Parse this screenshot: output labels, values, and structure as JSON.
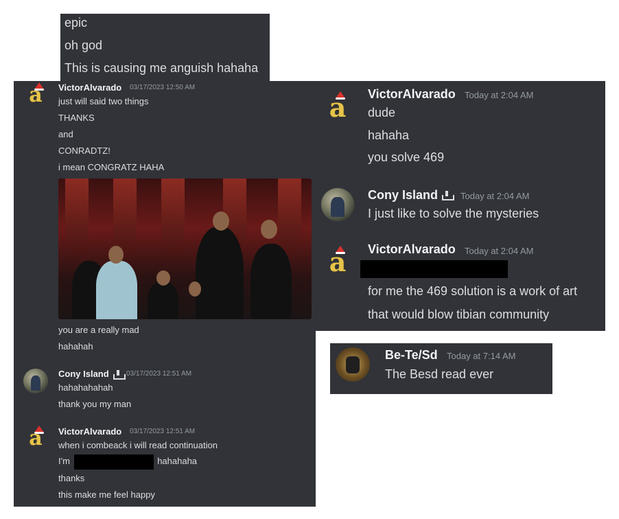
{
  "top_panel": {
    "lines": [
      "epic",
      "oh god",
      "This is causing me anguish hahaha"
    ]
  },
  "left_panel": {
    "messages": [
      {
        "author": "VictorAlvarado",
        "timestamp": "03/17/2023 12:50 AM",
        "avatar": "golden-a-santa-hat-icon",
        "lines": [
          "just will said two things",
          "THANKS",
          "and",
          "CONRADTZ!",
          "i mean CONGRATZ HAHA"
        ],
        "attachment": "applause-gif",
        "after_lines": [
          "you are a really mad",
          "hahahah"
        ]
      },
      {
        "author": "Cony Island",
        "timestamp": "03/17/2023 12:51 AM",
        "avatar": "profile-photo-avatar",
        "badge": "bot-tray-icon",
        "lines": [
          "hahahahahah",
          "thank you my man"
        ]
      },
      {
        "author": "VictorAlvarado",
        "timestamp": "03/17/2023 12:51 AM",
        "avatar": "golden-a-santa-hat-icon",
        "lines": [
          "when i combeack i will read continuation"
        ],
        "redacted_prefix": "I'm",
        "redacted_suffix": "hahahaha",
        "lines_after": [
          "thanks",
          "this make me feel happy"
        ]
      }
    ]
  },
  "right_panel": {
    "messages": [
      {
        "author": "VictorAlvarado",
        "timestamp": "Today at 2:04 AM",
        "avatar": "golden-a-santa-hat-icon",
        "lines": [
          "dude",
          "hahaha",
          "you solve 469"
        ]
      },
      {
        "author": "Cony Island",
        "timestamp": "Today at 2:04 AM",
        "avatar": "profile-photo-avatar",
        "badge": "bot-tray-icon",
        "lines": [
          "I just like to solve the mysteries"
        ]
      },
      {
        "author": "VictorAlvarado",
        "timestamp": "Today at 2:04 AM",
        "avatar": "golden-a-santa-hat-icon",
        "lines": [
          "for me the 469 solution is a work of art",
          "that would blow tibian community"
        ]
      }
    ]
  },
  "bottom_panel": {
    "author": "Be-Te/Sd",
    "timestamp": "Today at 7:14 AM",
    "avatar": "coin-avatar",
    "lines": [
      "The Besd read ever"
    ]
  },
  "colors": {
    "panel_bg": "#313338",
    "text": "#dbdee1",
    "author": "#f2f3f5",
    "timestamp": "#949ba4",
    "redaction": "#000000"
  }
}
